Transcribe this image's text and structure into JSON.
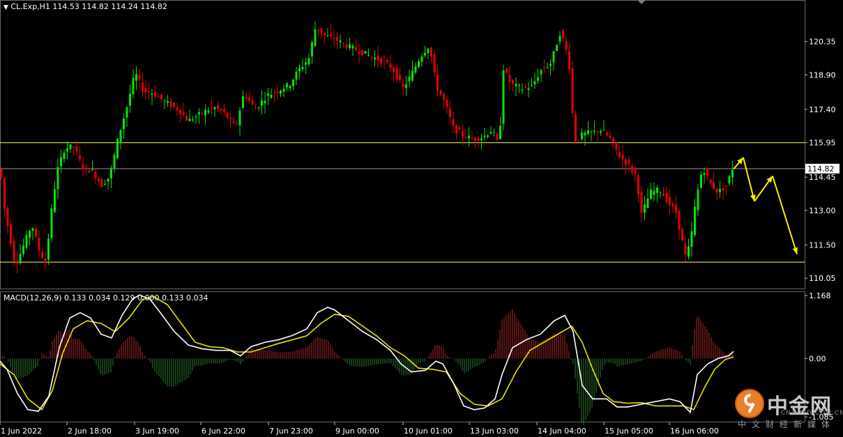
{
  "header": {
    "triangle": "▼",
    "symbol_line": "CL.Exp,H1  114.53 114.82 114.24 114.82"
  },
  "macd_header": "MACD(12,26,9) 0.133 0.034 0.129 0.000 0.133 0.034",
  "price_axis": {
    "ticks": [
      "120.35",
      "118.90",
      "117.40",
      "115.95",
      "114.45",
      "113.00",
      "111.50",
      "110.05"
    ],
    "current_price": "114.82"
  },
  "macd_axis": {
    "ticks": [
      "1.168",
      "0.00",
      "-1.085"
    ]
  },
  "time_axis": {
    "ticks": [
      "1 Jun 2022",
      "2 Jun 18:00",
      "3 Jun 19:00",
      "6 Jun 22:00",
      "7 Jun 23:00",
      "9 Jun 00:00",
      "10 Jun 01:00",
      "13 Jun 03:00",
      "14 Jun 04:00",
      "15 Jun 05:00",
      "16 Jun 06:00"
    ]
  },
  "colors": {
    "bull": "#00e600",
    "bear": "#e60000",
    "hline": "#ffff66",
    "current_line": "#9a9a9a",
    "arrow": "#ffee00",
    "macd_pos": "#b02a2a",
    "macd_neg": "#2f7a2f",
    "macd_line": "#ffffff",
    "signal_line": "#e6e600"
  },
  "watermark": {
    "brand": "中金网",
    "domain": "CNGOLD.COM.CN",
    "tagline": "中文财经新媒体"
  },
  "chart_data": [
    {
      "type": "candlestick",
      "symbol": "CL.Exp",
      "timeframe": "H1",
      "ylim": [
        109.6,
        122.1
      ],
      "horizontal_levels": [
        115.95,
        110.75
      ],
      "current_price": 114.82,
      "price_path": [
        [
          0,
          115.8
        ],
        [
          8,
          113.2
        ],
        [
          18,
          111.6
        ],
        [
          24,
          110.6
        ],
        [
          35,
          111.4
        ],
        [
          48,
          112.4
        ],
        [
          58,
          111.3
        ],
        [
          68,
          110.7
        ],
        [
          74,
          112.5
        ],
        [
          84,
          114.7
        ],
        [
          95,
          115.7
        ],
        [
          108,
          115.8
        ],
        [
          120,
          114.9
        ],
        [
          135,
          114.7
        ],
        [
          148,
          114.1
        ],
        [
          160,
          114.5
        ],
        [
          172,
          116.2
        ],
        [
          185,
          117.6
        ],
        [
          196,
          119.0
        ],
        [
          208,
          118.2
        ],
        [
          222,
          118.1
        ],
        [
          240,
          117.7
        ],
        [
          258,
          117.4
        ],
        [
          272,
          116.9
        ],
        [
          290,
          117.2
        ],
        [
          308,
          117.5
        ],
        [
          322,
          117.3
        ],
        [
          340,
          116.6
        ],
        [
          352,
          118.1
        ],
        [
          368,
          117.4
        ],
        [
          385,
          118.0
        ],
        [
          400,
          118.2
        ],
        [
          418,
          118.5
        ],
        [
          430,
          119.1
        ],
        [
          445,
          119.6
        ],
        [
          455,
          121.0
        ],
        [
          468,
          120.6
        ],
        [
          480,
          120.5
        ],
        [
          492,
          120.3
        ],
        [
          505,
          120.1
        ],
        [
          520,
          119.9
        ],
        [
          535,
          119.7
        ],
        [
          550,
          119.5
        ],
        [
          565,
          119.2
        ],
        [
          580,
          118.3
        ],
        [
          592,
          118.9
        ],
        [
          605,
          119.7
        ],
        [
          618,
          120.2
        ],
        [
          628,
          118.4
        ],
        [
          640,
          117.7
        ],
        [
          652,
          116.6
        ],
        [
          665,
          116.3
        ],
        [
          680,
          116.1
        ],
        [
          695,
          116.2
        ],
        [
          708,
          116.5
        ],
        [
          718,
          115.8
        ],
        [
          724,
          119.2
        ],
        [
          735,
          118.5
        ],
        [
          750,
          118.3
        ],
        [
          765,
          118.4
        ],
        [
          778,
          119.1
        ],
        [
          792,
          119.4
        ],
        [
          806,
          120.8
        ],
        [
          818,
          119.6
        ],
        [
          826,
          116.0
        ],
        [
          838,
          116.3
        ],
        [
          850,
          116.4
        ],
        [
          865,
          116.5
        ],
        [
          878,
          116.1
        ],
        [
          890,
          115.4
        ],
        [
          903,
          115.0
        ],
        [
          915,
          114.5
        ],
        [
          922,
          112.8
        ],
        [
          935,
          113.8
        ],
        [
          948,
          113.9
        ],
        [
          960,
          113.4
        ],
        [
          972,
          112.9
        ],
        [
          985,
          111.0
        ],
        [
          992,
          111.5
        ],
        [
          1000,
          113.4
        ],
        [
          1010,
          114.9
        ],
        [
          1020,
          114.2
        ],
        [
          1032,
          113.8
        ],
        [
          1045,
          114.1
        ],
        [
          1052,
          114.82
        ]
      ],
      "forecast_arrows": [
        {
          "from": [
            1052,
            114.8
          ],
          "to": [
            1066,
            115.3
          ]
        },
        {
          "from": [
            1066,
            115.3
          ],
          "to": [
            1082,
            113.4
          ]
        },
        {
          "from": [
            1082,
            113.4
          ],
          "to": [
            1108,
            114.5
          ]
        },
        {
          "from": [
            1108,
            114.5
          ],
          "to": [
            1143,
            111.1
          ]
        }
      ]
    },
    {
      "type": "line+histogram",
      "name": "MACD(12,26,9)",
      "ylim": [
        -1.16,
        1.22
      ],
      "macd": [
        [
          0,
          -0.05
        ],
        [
          10,
          -0.2
        ],
        [
          25,
          -0.65
        ],
        [
          40,
          -0.95
        ],
        [
          55,
          -0.98
        ],
        [
          70,
          -0.7
        ],
        [
          85,
          0.2
        ],
        [
          100,
          0.75
        ],
        [
          115,
          0.85
        ],
        [
          130,
          0.75
        ],
        [
          145,
          0.45
        ],
        [
          160,
          0.38
        ],
        [
          175,
          0.8
        ],
        [
          190,
          1.1
        ],
        [
          200,
          1.18
        ],
        [
          215,
          1.1
        ],
        [
          230,
          0.85
        ],
        [
          250,
          0.5
        ],
        [
          270,
          0.25
        ],
        [
          290,
          0.18
        ],
        [
          310,
          0.15
        ],
        [
          330,
          0.15
        ],
        [
          345,
          0.05
        ],
        [
          360,
          0.22
        ],
        [
          380,
          0.3
        ],
        [
          400,
          0.35
        ],
        [
          420,
          0.43
        ],
        [
          440,
          0.55
        ],
        [
          455,
          0.85
        ],
        [
          470,
          0.95
        ],
        [
          480,
          0.9
        ],
        [
          500,
          0.7
        ],
        [
          520,
          0.5
        ],
        [
          540,
          0.35
        ],
        [
          560,
          0.15
        ],
        [
          575,
          -0.1
        ],
        [
          590,
          -0.25
        ],
        [
          610,
          -0.22
        ],
        [
          625,
          -0.05
        ],
        [
          635,
          -0.1
        ],
        [
          650,
          -0.45
        ],
        [
          665,
          -0.88
        ],
        [
          680,
          -0.95
        ],
        [
          695,
          -0.92
        ],
        [
          710,
          -0.75
        ],
        [
          720,
          -0.3
        ],
        [
          735,
          0.2
        ],
        [
          755,
          0.35
        ],
        [
          775,
          0.45
        ],
        [
          795,
          0.7
        ],
        [
          810,
          0.8
        ],
        [
          822,
          0.5
        ],
        [
          835,
          -0.5
        ],
        [
          850,
          -0.75
        ],
        [
          870,
          -0.75
        ],
        [
          885,
          -0.9
        ],
        [
          900,
          -0.9
        ],
        [
          920,
          -0.85
        ],
        [
          940,
          -0.8
        ],
        [
          960,
          -0.75
        ],
        [
          975,
          -0.8
        ],
        [
          990,
          -1.0
        ],
        [
          1000,
          -0.3
        ],
        [
          1015,
          -0.1
        ],
        [
          1030,
          0.0
        ],
        [
          1045,
          0.05
        ],
        [
          1052,
          0.13
        ]
      ],
      "signal": [
        [
          0,
          -0.1
        ],
        [
          20,
          -0.3
        ],
        [
          40,
          -0.75
        ],
        [
          60,
          -0.95
        ],
        [
          75,
          -0.6
        ],
        [
          90,
          0.1
        ],
        [
          105,
          0.55
        ],
        [
          125,
          0.7
        ],
        [
          145,
          0.65
        ],
        [
          165,
          0.5
        ],
        [
          185,
          0.75
        ],
        [
          205,
          1.1
        ],
        [
          220,
          1.15
        ],
        [
          240,
          1.0
        ],
        [
          260,
          0.65
        ],
        [
          280,
          0.3
        ],
        [
          300,
          0.22
        ],
        [
          320,
          0.2
        ],
        [
          340,
          0.12
        ],
        [
          360,
          0.12
        ],
        [
          380,
          0.2
        ],
        [
          400,
          0.28
        ],
        [
          420,
          0.35
        ],
        [
          440,
          0.42
        ],
        [
          460,
          0.65
        ],
        [
          480,
          0.82
        ],
        [
          500,
          0.78
        ],
        [
          520,
          0.6
        ],
        [
          540,
          0.42
        ],
        [
          560,
          0.2
        ],
        [
          580,
          0.05
        ],
        [
          600,
          -0.18
        ],
        [
          620,
          -0.2
        ],
        [
          640,
          -0.25
        ],
        [
          660,
          -0.65
        ],
        [
          680,
          -0.85
        ],
        [
          700,
          -0.88
        ],
        [
          720,
          -0.75
        ],
        [
          740,
          -0.25
        ],
        [
          760,
          0.15
        ],
        [
          780,
          0.3
        ],
        [
          800,
          0.45
        ],
        [
          820,
          0.6
        ],
        [
          835,
          0.3
        ],
        [
          850,
          -0.2
        ],
        [
          865,
          -0.65
        ],
        [
          880,
          -0.8
        ],
        [
          900,
          -0.83
        ],
        [
          920,
          -0.82
        ],
        [
          940,
          -0.88
        ],
        [
          960,
          -0.88
        ],
        [
          980,
          -0.88
        ],
        [
          995,
          -0.95
        ],
        [
          1010,
          -0.55
        ],
        [
          1025,
          -0.2
        ],
        [
          1040,
          -0.02
        ],
        [
          1052,
          0.03
        ]
      ]
    }
  ]
}
